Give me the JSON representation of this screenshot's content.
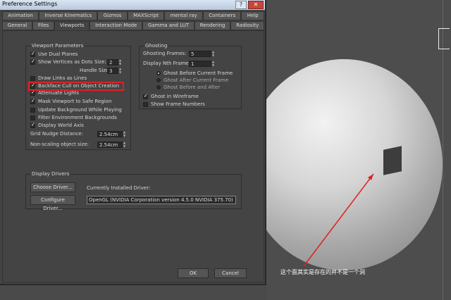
{
  "window": {
    "title": "Preference Settings",
    "help": "?",
    "close": "✕"
  },
  "tabs_row1": [
    "Animation",
    "Inverse Kinematics",
    "Gizmos",
    "MAXScript",
    "mental ray",
    "Containers",
    "Help"
  ],
  "tabs_row2": [
    "General",
    "Files",
    "Viewports",
    "Interaction Mode",
    "Gamma and LUT",
    "Rendering",
    "Radiosity"
  ],
  "viewport_parameters": {
    "title": "Viewport Parameters",
    "use_dual_planes": "Use Dual Planes",
    "show_vertices_as_dots": "Show Vertices as Dots",
    "size_label": "Size:",
    "size_value": "2",
    "handle_size_label": "Handle Size:",
    "handle_size_value": "3",
    "draw_links_as_lines": "Draw Links as Lines",
    "backface_cull": "Backface Cull on Object Creation",
    "attenuate_lights": "Attenuate Lights",
    "mask_viewport": "Mask Viewport to Safe Region",
    "update_background": "Update Background While Playing",
    "filter_env": "Filter Environment Backgrounds",
    "display_world_axis": "Display World Axis",
    "grid_nudge_label": "Grid Nudge Distance:",
    "grid_nudge_value": "2.54cm",
    "non_scaling_label": "Non-scaling object size:",
    "non_scaling_value": "2.54cm"
  },
  "ghosting": {
    "title": "Ghosting",
    "frames_label": "Ghosting Frames:",
    "frames_value": "5",
    "nth_label": "Display Nth Frame:",
    "nth_value": "1",
    "before": "Ghost Before Current Frame",
    "after": "Ghost After Current Frame",
    "before_after": "Ghost Before and After",
    "wireframe": "Ghost in Wireframe",
    "frame_numbers": "Show Frame Numbers"
  },
  "display_drivers": {
    "title": "Display Drivers",
    "choose": "Choose Driver...",
    "installed_label": "Currently Installed Driver:",
    "configure": "Configure Driver...",
    "driver_value": "OpenGL (NVIDIA Corporation version 4.5.0 NVIDIA 375.70)"
  },
  "buttons": {
    "ok": "OK",
    "cancel": "Cancel"
  },
  "annotation": "这个面其实是存在的并不是一个洞"
}
